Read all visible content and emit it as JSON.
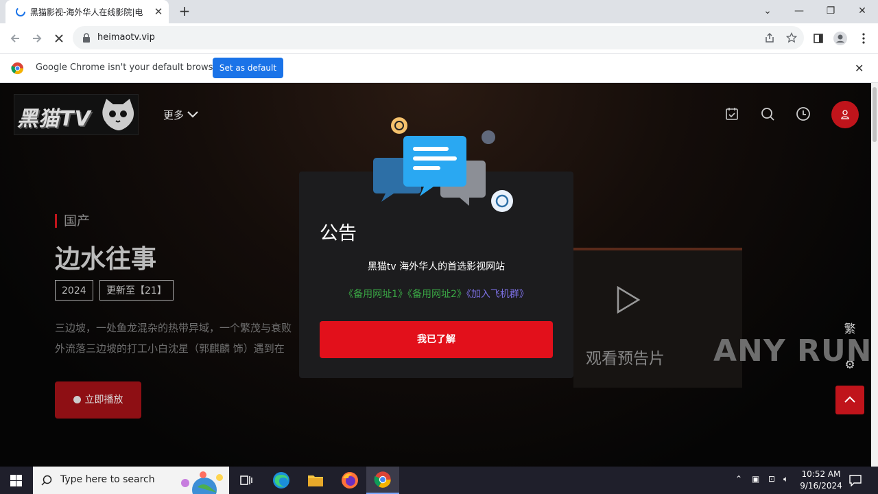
{
  "browser": {
    "tab_title": "黑猫影视-海外华人在线影院|电",
    "url": "heimaotv.vip",
    "infobar_message": "Google Chrome isn't your default browser",
    "set_default_label": "Set as default"
  },
  "site": {
    "logo_text": "黑猫TV",
    "nav_more": "更多",
    "category": "国产",
    "title": "边水往事",
    "tags": [
      "2024",
      "更新至【21】"
    ],
    "description_line1": "三边坡，一处鱼龙混杂的热带异域，一个繁茂与衰败",
    "description_line2": "外流落三边坡的打工小白沈星（郭麒麟 饰）遇到在",
    "play_label": "立即播放",
    "trailer_label": "观看预告片",
    "side_traditional": "繁"
  },
  "modal": {
    "title": "公告",
    "text": "黑猫tv 海外华人的首选影视网站",
    "link1": "《备用网址1》",
    "link2": "《备用网址2》",
    "link3": "《加入飞机群》",
    "confirm_label": "我已了解"
  },
  "taskbar": {
    "search_placeholder": "Type here to search",
    "time": "10:52 AM",
    "date": "9/16/2024"
  },
  "watermark": "ANY RUN",
  "colors": {
    "accent_red": "#e2101b",
    "dark_red": "#8e0f14",
    "link_green": "#3aa845",
    "link_purple": "#7a6ee0",
    "chrome_blue": "#1a73e8"
  }
}
